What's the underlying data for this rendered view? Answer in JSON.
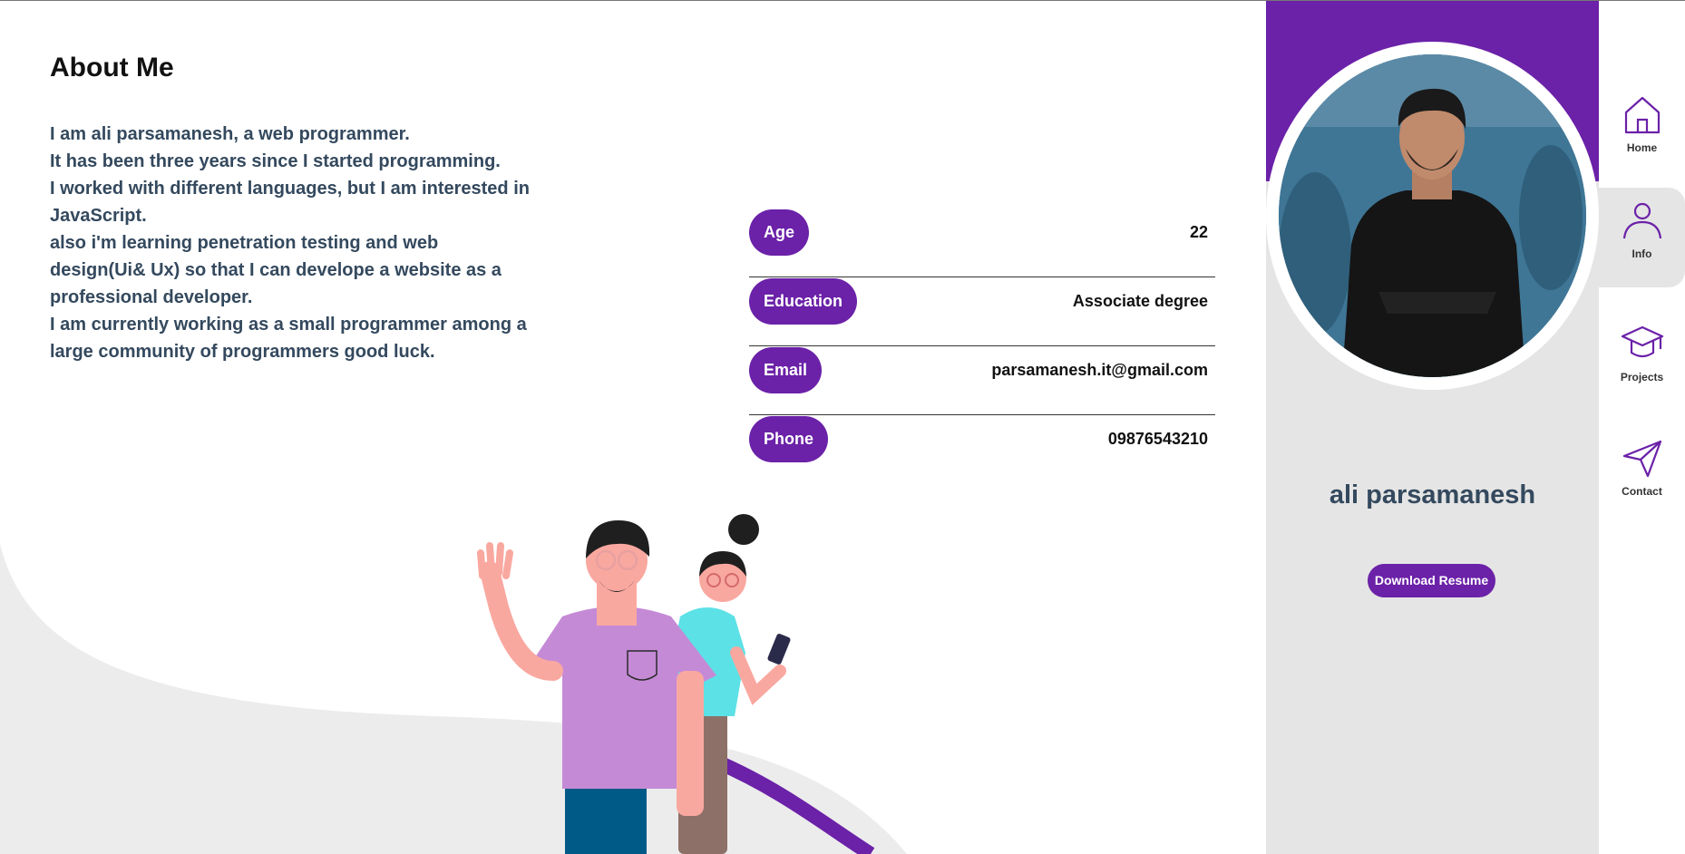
{
  "about": {
    "title": "About Me",
    "bio": [
      "I am ali parsamanesh, a web programmer.",
      "It has been three years since I started programming.",
      "I worked with different languages, but I am interested in JavaScript.",
      "also i'm learning penetration testing and web design(Ui& Ux) so that I can develope a website as a professional developer.",
      "I am currently working as a small programmer among a large community of programmers good luck."
    ]
  },
  "info": [
    {
      "key": "Age",
      "value": "22"
    },
    {
      "key": "Education",
      "value": "Associate degree"
    },
    {
      "key": "Email",
      "value": "parsamanesh.it@gmail.com"
    },
    {
      "key": "Phone",
      "value": "09876543210"
    }
  ],
  "profile": {
    "name": "ali parsamanesh",
    "download_label": "Download Resume"
  },
  "nav": {
    "items": [
      {
        "label": "Home",
        "icon": "home-icon"
      },
      {
        "label": "Info",
        "icon": "user-icon",
        "active": true
      },
      {
        "label": "Projects",
        "icon": "graduation-cap-icon"
      },
      {
        "label": "Contact",
        "icon": "paper-plane-icon"
      }
    ]
  },
  "colors": {
    "accent": "#6b21a8",
    "panel": "#e5e5e5",
    "text": "#34495e"
  }
}
